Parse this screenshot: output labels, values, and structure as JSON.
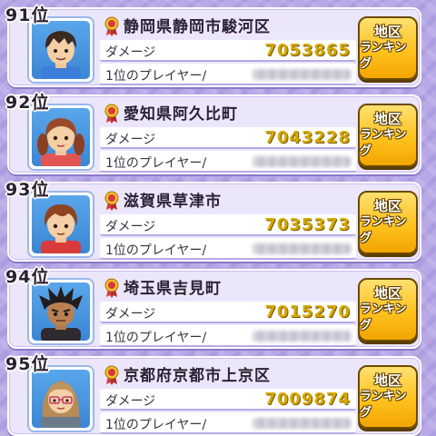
{
  "entries": [
    {
      "rank": "91位",
      "area": "静岡県静岡市駿河区",
      "damage_label": "ダメージ",
      "damage": "7053865",
      "player_label": "1位のプレイヤー/",
      "button_line1": "地区",
      "button_line2": "ランキング",
      "avatar": "boy-black-hair-icon"
    },
    {
      "rank": "92位",
      "area": "愛知県阿久比町",
      "damage_label": "ダメージ",
      "damage": "7043228",
      "player_label": "1位のプレイヤー/",
      "button_line1": "地区",
      "button_line2": "ランキング",
      "avatar": "girl-brown-pigtails-icon"
    },
    {
      "rank": "93位",
      "area": "滋賀県草津市",
      "damage_label": "ダメージ",
      "damage": "7035373",
      "player_label": "1位のプレイヤー/",
      "button_line1": "地区",
      "button_line2": "ランキング",
      "avatar": "boy-brown-hair-icon"
    },
    {
      "rank": "94位",
      "area": "埼玉県吉見町",
      "damage_label": "ダメージ",
      "damage": "7015270",
      "player_label": "1位のプレイヤー/",
      "button_line1": "地区",
      "button_line2": "ランキング",
      "avatar": "boy-spiky-dark-hair-icon"
    },
    {
      "rank": "95位",
      "area": "京都府京都市上京区",
      "damage_label": "ダメージ",
      "damage": "7009874",
      "player_label": "1位のプレイヤー/",
      "button_line1": "地区",
      "button_line2": "ランキング",
      "avatar": "girl-glasses-icon"
    }
  ]
}
